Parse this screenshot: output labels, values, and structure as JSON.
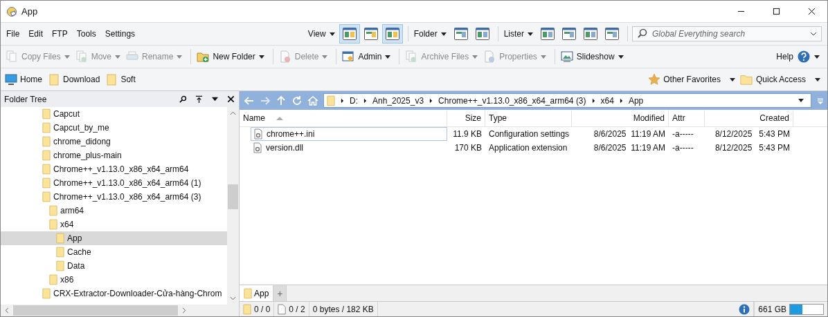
{
  "window": {
    "title": "App"
  },
  "menu": [
    "File",
    "Edit",
    "FTP",
    "Tools",
    "Settings"
  ],
  "view_groups": [
    {
      "label": "View",
      "buttons": [
        {
          "on": true
        },
        {
          "on": false
        },
        {
          "on": true
        }
      ]
    },
    {
      "label": "Folder",
      "buttons": [
        {
          "on": false
        },
        {
          "on": false
        }
      ]
    },
    {
      "label": "Lister",
      "buttons": [
        {
          "on": false
        },
        {
          "on": false
        },
        {
          "on": false
        },
        {
          "on": false
        }
      ]
    }
  ],
  "search": {
    "placeholder": "Global Everything search"
  },
  "commands": [
    {
      "label": "Copy Files",
      "disabled": true
    },
    {
      "label": "Move",
      "disabled": true
    },
    {
      "label": "Rename",
      "disabled": true
    },
    {
      "label": "New Folder",
      "disabled": false
    },
    {
      "label": "Delete",
      "disabled": true
    },
    {
      "label": "Admin",
      "disabled": false
    },
    {
      "label": "Archive Files",
      "disabled": true
    },
    {
      "label": "Properties",
      "disabled": true
    },
    {
      "label": "Slideshow",
      "disabled": false
    }
  ],
  "help": {
    "label": "Help"
  },
  "favorites": [
    "Home",
    "Download",
    "Soft"
  ],
  "favorites_right": [
    "Other Favorites",
    "Quick Access"
  ],
  "folder_tree": {
    "title": "Folder Tree",
    "items": [
      {
        "label": "Capcut",
        "selected": false
      },
      {
        "label": "Capcut_by_me",
        "selected": false
      },
      {
        "label": "chrome_didong",
        "selected": false
      },
      {
        "label": "chrome_plus-main",
        "selected": false
      },
      {
        "label": "Chrome++_v1.13.0_x86_x64_arm64",
        "selected": false
      },
      {
        "label": "Chrome++_v1.13.0_x86_x64_arm64 (1)",
        "selected": false
      },
      {
        "label": "Chrome++_v1.13.0_x86_x64_arm64 (3)",
        "selected": false,
        "children": [
          {
            "label": "arm64",
            "selected": false
          },
          {
            "label": "x64",
            "selected": false,
            "children": [
              {
                "label": "App",
                "selected": true
              },
              {
                "label": "Cache",
                "selected": false
              },
              {
                "label": "Data",
                "selected": false
              }
            ]
          },
          {
            "label": "x86",
            "selected": false
          }
        ]
      },
      {
        "label": "CRX-Extractor-Downloader-Cửa-hàng-Chrom",
        "selected": false
      }
    ]
  },
  "path": [
    "D:",
    "Anh_2025_v3",
    "Chrome++_v1.13.0_x86_x64_arm64 (3)",
    "x64",
    "App"
  ],
  "files": {
    "columns": [
      "Name",
      "Size",
      "Type",
      "Modified",
      "Attr",
      "Created"
    ],
    "rows": [
      {
        "name": "chrome++.ini",
        "size": "11.9 KB",
        "type": "Configuration settings",
        "modified": "8/6/2025  11:19 AM",
        "attr": "-a-----",
        "created": "8/12/2025   5:43 PM",
        "focused": true
      },
      {
        "name": "version.dll",
        "size": "170 KB",
        "type": "Application extension",
        "modified": "8/6/2025  11:19 AM",
        "attr": "-a-----",
        "created": "8/12/2025   5:43 PM",
        "focused": false
      }
    ]
  },
  "tabs": [
    {
      "label": "App",
      "selected": true
    }
  ],
  "add_tab": "+",
  "status_bar": {
    "folders": "0 / 0",
    "files": "0 / 2",
    "bytes": "0 bytes / 182 KB",
    "free": "661 GB",
    "level": 0.38
  }
}
